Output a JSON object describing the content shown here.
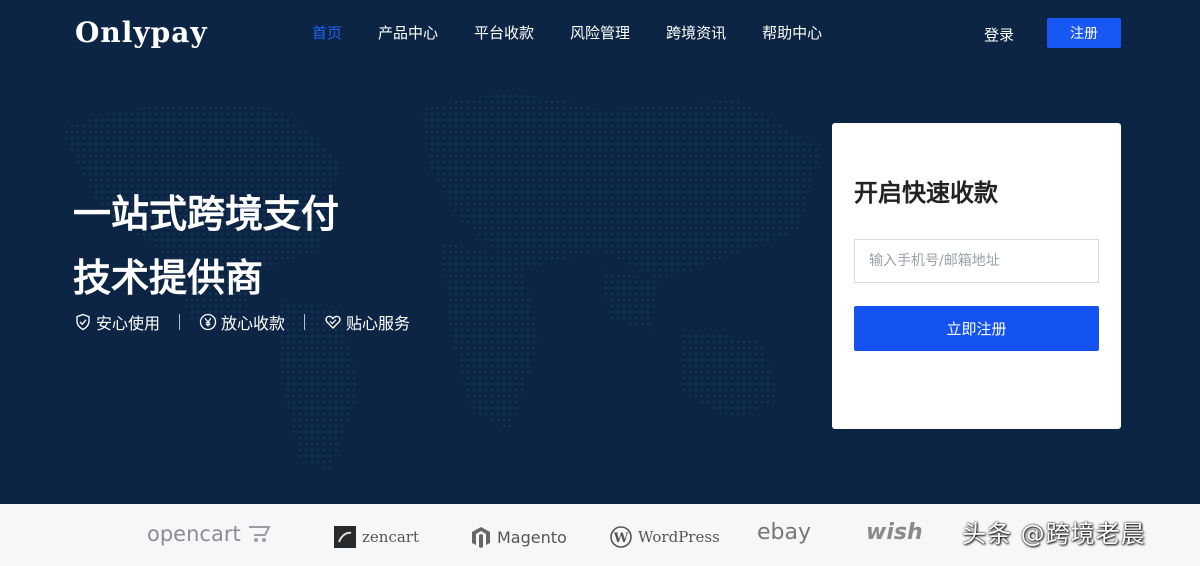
{
  "brand": {
    "logo": "Onlypay"
  },
  "nav": {
    "items": [
      {
        "label": "首页",
        "active": true
      },
      {
        "label": "产品中心",
        "active": false
      },
      {
        "label": "平台收款",
        "active": false
      },
      {
        "label": "风险管理",
        "active": false
      },
      {
        "label": "跨境资讯",
        "active": false
      },
      {
        "label": "帮助中心",
        "active": false
      }
    ],
    "login": "登录",
    "register": "注册"
  },
  "hero": {
    "headline_line1": "一站式跨境支付",
    "headline_line2": "技术提供商",
    "features": [
      {
        "icon": "shield-check-icon",
        "label": "安心使用"
      },
      {
        "icon": "yen-icon",
        "label": "放心收款"
      },
      {
        "icon": "heart-icon",
        "label": "贴心服务"
      }
    ]
  },
  "signup": {
    "title": "开启快速收款",
    "input_placeholder": "输入手机号/邮箱地址",
    "button": "立即注册"
  },
  "partners": {
    "opencart": "opencart",
    "zencart": "zencart",
    "magento": "Magento",
    "wordpress": "WordPress",
    "ebay": "ebay",
    "wish": "wish"
  },
  "watermark": "头条 @跨境老晨",
  "colors": {
    "hero_bg": "#0c2545",
    "accent": "#1757f4",
    "nav_active": "#1b64f6",
    "partners_bg": "#f6f7f9"
  }
}
